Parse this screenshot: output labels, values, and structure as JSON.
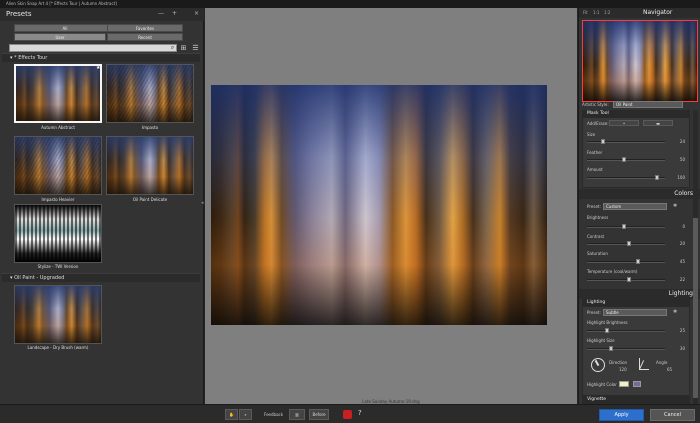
{
  "window": {
    "title": "Alien Skin Snap Art 4 [* Effects Tour | Autumn Abstract]"
  },
  "left_panel": {
    "title": "Presets",
    "minimize": "—",
    "add": "+",
    "close": "×",
    "filters": [
      {
        "label": "All",
        "active": false
      },
      {
        "label": "Favorites",
        "active": false
      },
      {
        "label": "User",
        "active": true
      },
      {
        "label": "Recent",
        "active": false
      }
    ],
    "groups": [
      {
        "name": "* Effects Tour",
        "presets": [
          "Autumn Abstract",
          "Impasto",
          "Impasto Heavier",
          "Oil Paint Delicate",
          "Stylize - TWI Version"
        ]
      },
      {
        "name": "Oil Paint - Upgraded",
        "presets": [
          "Landscape - Dry Brush (warm)"
        ]
      }
    ]
  },
  "center": {
    "filename": "Late Sunday Autumn-19.dng"
  },
  "right_panel": {
    "navigator": {
      "title": "Navigator",
      "zoom_options": [
        "Fit",
        "1:1",
        "1:2"
      ]
    },
    "artistic_style": {
      "label": "Artistic Style:",
      "value": "Oil Paint"
    },
    "mask_tool": {
      "title": "Mask Tool",
      "add_erase_label": "Add/Erase:",
      "size": {
        "label": "Size",
        "value": "24",
        "fraction": 0.05
      },
      "feather": {
        "label": "Feather",
        "value": "50",
        "fraction": 0.5
      },
      "amount": {
        "label": "Amount",
        "value": "100",
        "fraction": 1.0
      }
    },
    "colors": {
      "title": "Colors",
      "preset_label": "Preset:",
      "preset_value": "Custom",
      "brightness": {
        "label": "Brightness",
        "value": "0",
        "fraction": 0.5
      },
      "contrast": {
        "label": "Contrast",
        "value": "20",
        "fraction": 0.6
      },
      "saturation": {
        "label": "Saturation",
        "value": "45",
        "fraction": 0.73
      },
      "temperature": {
        "label": "Temperature (cool/warm)",
        "value": "22",
        "fraction": 0.61
      }
    },
    "lighting": {
      "title": "Lighting",
      "sub_title": "Lighting",
      "preset_label": "Preset:",
      "preset_value": "Subtle",
      "highlight_brightness": {
        "label": "Highlight Brightness",
        "value": "25",
        "fraction": 0.25
      },
      "highlight_size": {
        "label": "Highlight Size",
        "value": "30",
        "fraction": 0.3
      },
      "direction": {
        "label": "Direction",
        "value": "120"
      },
      "angle": {
        "label": "Angle",
        "value": "65"
      },
      "highlight_color_label": "Highlight Color"
    },
    "vignette": {
      "title": "Vignette"
    }
  },
  "bottom_bar": {
    "feedback_label": "Feedback",
    "before_label": "Before",
    "apply_label": "Apply",
    "cancel_label": "Cancel"
  },
  "colors": {
    "accent": "#2c6fcc",
    "nav_border": "#ff3a3a"
  }
}
